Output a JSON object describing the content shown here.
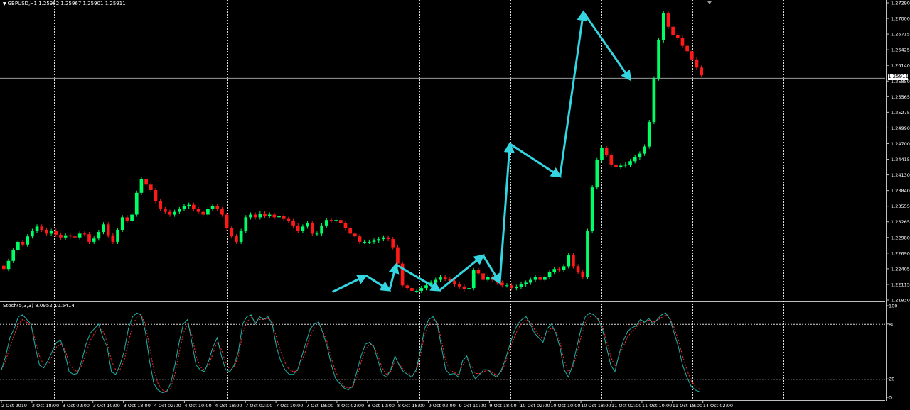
{
  "header": {
    "symbol_info": "GBPUSD,H1  1.25962 1.25967 1.25901 1.25911",
    "collapse_icon": "triangle-down-icon"
  },
  "indicator": {
    "label": "Stoch(5,3,3) 8.0952 10.5414"
  },
  "price_axis": {
    "ticks": [
      "1.27290",
      "1.27000",
      "1.26715",
      "1.26425",
      "1.26140",
      "1.25850",
      "1.25565",
      "1.25275",
      "1.24990",
      "1.24700",
      "1.24415",
      "1.24130",
      "1.23840",
      "1.23555",
      "1.23265",
      "1.22980",
      "1.22690",
      "1.22405",
      "1.22115",
      "1.21830"
    ],
    "current_price": "1.25911"
  },
  "stoch_axis": {
    "ticks": [
      "100",
      "80",
      "20",
      "0"
    ]
  },
  "time_axis": {
    "ticks": [
      "2 Oct 2019",
      "2 Oct 18:00",
      "3 Oct 02:00",
      "3 Oct 10:00",
      "3 Oct 18:00",
      "4 Oct 02:00",
      "4 Oct 10:00",
      "4 Oct 18:00",
      "7 Oct 02:00",
      "7 Oct 10:00",
      "7 Oct 18:00",
      "8 Oct 02:00",
      "8 Oct 10:00",
      "8 Oct 18:00",
      "9 Oct 02:00",
      "9 Oct 10:00",
      "9 Oct 18:00",
      "10 Oct 02:00",
      "10 Oct 10:00",
      "10 Oct 18:00",
      "11 Oct 02:00",
      "11 Oct 10:00",
      "11 Oct 18:00",
      "14 Oct 02:00"
    ]
  },
  "colors": {
    "background": "#000000",
    "bull": "#00ff66",
    "bear": "#ff1a1a",
    "zigzag": "#33d6e0",
    "stoch_main": "#20b2aa",
    "stoch_signal": "#ff3030",
    "grid": "#ffffff"
  },
  "chart_data": [
    {
      "type": "candlestick",
      "symbol": "GBPUSD",
      "timeframe": "H1",
      "ylim": [
        1.2183,
        1.2729
      ],
      "closes": [
        1.224,
        1.2255,
        1.2275,
        1.229,
        1.2285,
        1.23,
        1.231,
        1.2318,
        1.2312,
        1.2305,
        1.231,
        1.2303,
        1.2298,
        1.2302,
        1.23,
        1.2298,
        1.2305,
        1.2304,
        1.229,
        1.2296,
        1.2308,
        1.2322,
        1.2302,
        1.229,
        1.2312,
        1.2335,
        1.2328,
        1.234,
        1.238,
        1.2405,
        1.2395,
        1.2385,
        1.2365,
        1.235,
        1.2345,
        1.234,
        1.2345,
        1.235,
        1.2355,
        1.2358,
        1.235,
        1.2345,
        1.234,
        1.235,
        1.2355,
        1.235,
        1.234,
        1.2315,
        1.23,
        1.229,
        1.231,
        1.2335,
        1.234,
        1.2335,
        1.2342,
        1.2338,
        1.234,
        1.2335,
        1.2338,
        1.2332,
        1.2328,
        1.232,
        1.231,
        1.2318,
        1.2325,
        1.2305,
        1.2305,
        1.232,
        1.233,
        1.2328,
        1.233,
        1.2325,
        1.2315,
        1.2305,
        1.23,
        1.229,
        1.229,
        1.229,
        1.2292,
        1.2295,
        1.2298,
        1.2295,
        1.228,
        1.225,
        1.221,
        1.2205,
        1.22,
        1.22,
        1.2205,
        1.221,
        1.2215,
        1.222,
        1.2225,
        1.2222,
        1.2218,
        1.2212,
        1.2208,
        1.2203,
        1.2205,
        1.2238,
        1.2232,
        1.222,
        1.2225,
        1.222,
        1.2215,
        1.221,
        1.221,
        1.2205,
        1.2207,
        1.2212,
        1.2215,
        1.222,
        1.2225,
        1.222,
        1.2225,
        1.2235,
        1.224,
        1.2238,
        1.2245,
        1.2265,
        1.2245,
        1.2235,
        1.2225,
        1.231,
        1.239,
        1.244,
        1.2462,
        1.245,
        1.2432,
        1.2428,
        1.243,
        1.2432,
        1.2438,
        1.2445,
        1.2452,
        1.2465,
        1.251,
        1.259,
        1.266,
        1.271,
        1.2685,
        1.267,
        1.2665,
        1.265,
        1.264,
        1.2625,
        1.261,
        1.2596
      ],
      "zigzag": [
        {
          "x": "8 Oct 09:00",
          "y": 1.2198
        },
        {
          "x": "8 Oct 19:00",
          "y": 1.2228
        },
        {
          "x": "9 Oct 02:00",
          "y": 1.2201
        },
        {
          "x": "9 Oct 04:00",
          "y": 1.2248
        },
        {
          "x": "9 Oct 17:00",
          "y": 1.2201
        },
        {
          "x": "10 Oct 06:00",
          "y": 1.2265
        },
        {
          "x": "10 Oct 11:00",
          "y": 1.2215
        },
        {
          "x": "10 Oct 14:00",
          "y": 1.247
        },
        {
          "x": "11 Oct 05:00",
          "y": 1.241
        },
        {
          "x": "11 Oct 12:00",
          "y": 1.2712
        },
        {
          "x": "14 Oct 02:00",
          "y": 1.2588
        }
      ]
    },
    {
      "type": "line",
      "name": "Stoch(5,3,3)",
      "ylim": [
        0,
        100
      ],
      "levels": [
        80,
        20
      ],
      "main": [
        30,
        45,
        65,
        75,
        88,
        90,
        85,
        80,
        55,
        35,
        32,
        40,
        50,
        60,
        62,
        48,
        28,
        25,
        26,
        40,
        58,
        70,
        75,
        80,
        65,
        55,
        28,
        25,
        35,
        50,
        75,
        88,
        92,
        90,
        72,
        40,
        15,
        8,
        5,
        6,
        15,
        35,
        60,
        80,
        85,
        60,
        35,
        30,
        28,
        40,
        55,
        65,
        45,
        30,
        28,
        35,
        50,
        80,
        88,
        90,
        80,
        88,
        85,
        88,
        80,
        55,
        40,
        30,
        25,
        25,
        30,
        45,
        60,
        75,
        80,
        82,
        70,
        55,
        35,
        20,
        15,
        10,
        8,
        12,
        28,
        45,
        58,
        60,
        55,
        40,
        25,
        22,
        30,
        45,
        35,
        28,
        25,
        22,
        30,
        50,
        75,
        85,
        88,
        80,
        55,
        30,
        25,
        26,
        22,
        40,
        45,
        30,
        20,
        25,
        30,
        30,
        25,
        22,
        28,
        40,
        55,
        70,
        80,
        85,
        88,
        80,
        70,
        65,
        60,
        75,
        80,
        70,
        55,
        30,
        22,
        35,
        55,
        75,
        88,
        92,
        90,
        85,
        75,
        55,
        35,
        28,
        48,
        62,
        72,
        76,
        78,
        85,
        82,
        86,
        80,
        85,
        90,
        92,
        85,
        70,
        55,
        35,
        22,
        12,
        8,
        6
      ],
      "signal": [
        30,
        40,
        55,
        68,
        80,
        85,
        82,
        78,
        62,
        45,
        35,
        35,
        45,
        55,
        58,
        52,
        38,
        30,
        28,
        35,
        48,
        62,
        70,
        76,
        72,
        60,
        40,
        30,
        30,
        40,
        60,
        78,
        88,
        90,
        80,
        55,
        30,
        15,
        8,
        6,
        10,
        25,
        48,
        70,
        80,
        68,
        45,
        33,
        30,
        35,
        48,
        60,
        52,
        38,
        30,
        33,
        45,
        70,
        82,
        88,
        82,
        85,
        85,
        86,
        82,
        65,
        50,
        38,
        30,
        28,
        29,
        40,
        52,
        68,
        76,
        80,
        72,
        60,
        42,
        28,
        18,
        12,
        10,
        11,
        22,
        38,
        52,
        58,
        56,
        45,
        32,
        25,
        28,
        40,
        36,
        30,
        27,
        24,
        28,
        45,
        68,
        80,
        85,
        82,
        62,
        40,
        30,
        27,
        25,
        35,
        42,
        35,
        26,
        26,
        28,
        30,
        27,
        24,
        27,
        36,
        50,
        63,
        74,
        81,
        85,
        82,
        74,
        68,
        64,
        70,
        76,
        72,
        60,
        40,
        28,
        32,
        48,
        66,
        82,
        88,
        89,
        86,
        78,
        62,
        44,
        34,
        45,
        56,
        66,
        72,
        76,
        82,
        82,
        84,
        82,
        84,
        87,
        90,
        86,
        76,
        62,
        45,
        30,
        18,
        12,
        9
      ]
    }
  ]
}
